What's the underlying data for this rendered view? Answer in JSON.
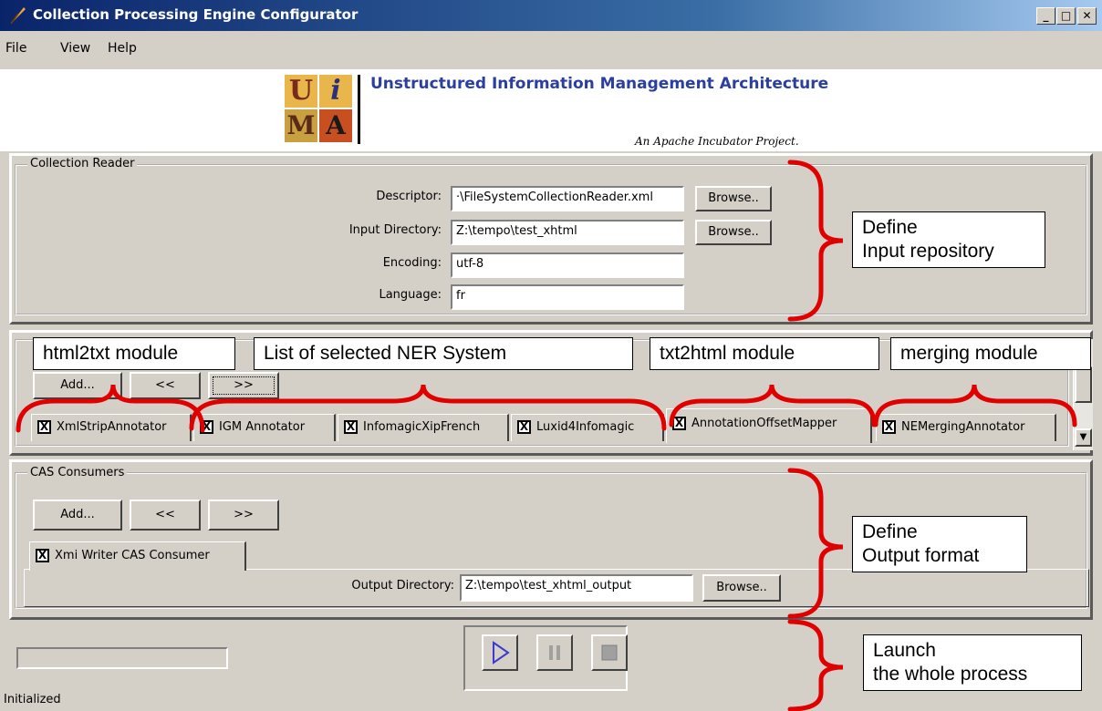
{
  "window": {
    "title": "Collection Processing Engine Configurator",
    "controls": {
      "minimize": "_",
      "maximize": "□",
      "close": "✕"
    }
  },
  "menu": [
    "File",
    "View",
    "Help"
  ],
  "header": {
    "logo_letters": [
      "U",
      "i",
      "M",
      "A"
    ],
    "title": "Unstructured Information Management Architecture",
    "subtitle": "An Apache Incubator Project."
  },
  "collection_reader": {
    "legend": "Collection Reader",
    "fields": [
      {
        "label": "Descriptor:",
        "value": "·\\FileSystemCollectionReader.xml",
        "button": "Browse.."
      },
      {
        "label": "Input Directory:",
        "value": "Z:\\tempo\\test_xhtml",
        "button": "Browse.."
      },
      {
        "label": "Encoding:",
        "value": "utf-8"
      },
      {
        "label": "Language:",
        "value": "fr"
      }
    ]
  },
  "analysis": {
    "buttons": [
      "Add...",
      "<<",
      ">>"
    ],
    "tabs": [
      "XmlStripAnnotator",
      "IGM Annotator",
      "InfomagicXipFrench",
      "Luxid4Infomagic",
      "AnnotationOffsetMapper",
      "NEMergingAnnotator"
    ],
    "check_mark": "X",
    "scroll_arrow": "▼"
  },
  "cas_consumers": {
    "legend": "CAS Consumers",
    "buttons": [
      "Add...",
      "<<",
      ">>"
    ],
    "tab": "Xmi Writer CAS Consumer",
    "output_label": "Output Directory:",
    "output_value": "Z:\\tempo\\test_xhtml_output",
    "browse": "Browse.."
  },
  "run": {
    "status": "Initialized",
    "progress": 0
  },
  "callouts": {
    "input": [
      "Define",
      "Input repository"
    ],
    "html2txt": "html2txt module",
    "ner_list": "List of selected NER System",
    "txt2html": "txt2html module",
    "merging": "merging module",
    "output": [
      "Define",
      "Output format"
    ],
    "launch": [
      "Launch",
      "the whole process"
    ]
  },
  "colors": {
    "titlebar_start": "#0a246a",
    "titlebar_end": "#a6caf0",
    "window_bg": "#d4d0c8",
    "uima_title": "#2b3fa0",
    "brace": "#e00000",
    "play_icon": "#3b3bd0"
  }
}
